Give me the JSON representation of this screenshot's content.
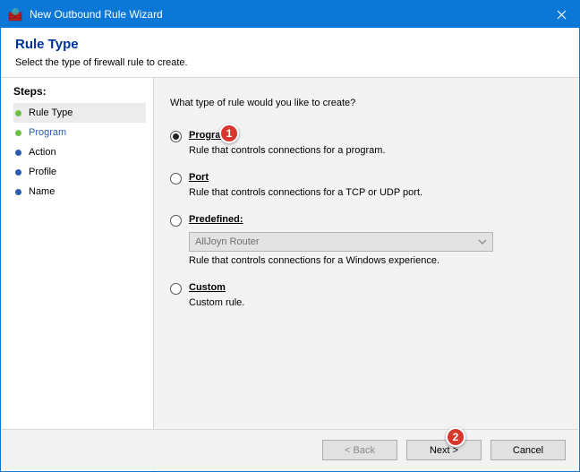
{
  "titlebar": {
    "title": "New Outbound Rule Wizard"
  },
  "header": {
    "heading": "Rule Type",
    "sub": "Select the type of firewall rule to create."
  },
  "steps": {
    "heading": "Steps:",
    "items": [
      {
        "label": "Rule Type",
        "bullet_color": "#6fbf44",
        "selected": true,
        "link": false
      },
      {
        "label": "Program",
        "bullet_color": "#6fbf44",
        "selected": false,
        "link": true
      },
      {
        "label": "Action",
        "bullet_color": "#2a5db0",
        "selected": false,
        "link": false
      },
      {
        "label": "Profile",
        "bullet_color": "#2a5db0",
        "selected": false,
        "link": false
      },
      {
        "label": "Name",
        "bullet_color": "#2a5db0",
        "selected": false,
        "link": false
      }
    ]
  },
  "main": {
    "prompt": "What type of rule would you like to create?",
    "options": [
      {
        "label": "Program",
        "desc": "Rule that controls connections for a program.",
        "checked": true,
        "dropdown": null
      },
      {
        "label": "Port",
        "desc": "Rule that controls connections for a TCP or UDP port.",
        "checked": false,
        "dropdown": null
      },
      {
        "label": "Predefined:",
        "desc": "Rule that controls connections for a Windows experience.",
        "checked": false,
        "dropdown": "AllJoyn Router"
      },
      {
        "label": "Custom",
        "desc": "Custom rule.",
        "checked": false,
        "dropdown": null
      }
    ]
  },
  "footer": {
    "back": "< Back",
    "next": "Next >",
    "cancel": "Cancel"
  },
  "callouts": {
    "one": "1",
    "two": "2"
  }
}
